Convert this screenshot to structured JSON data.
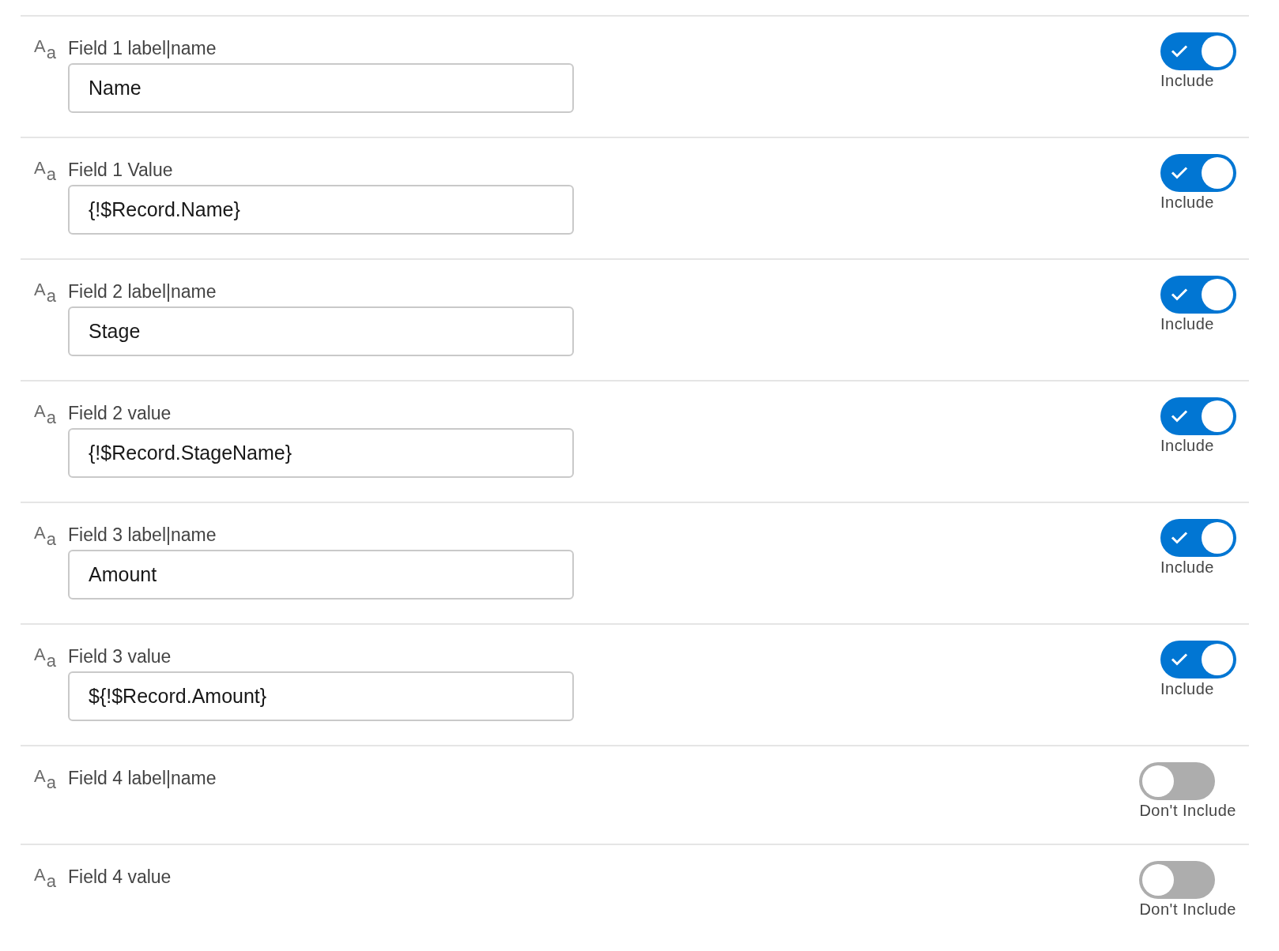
{
  "fields": [
    {
      "icon": "A$_{a}$",
      "label": "Field 1 label|name",
      "value": "Name",
      "include": {
        "checked": true,
        "label": "Include"
      }
    },
    {
      "icon": "A$_{a}$",
      "label": "Field 1 Value",
      "value": "{!$Record.Name}",
      "include": {
        "checked": true,
        "label": "Include"
      }
    },
    {
      "icon": "A$_{a}$",
      "label": "Field 2 label|name",
      "value": "Stage",
      "include": {
        "checked": true,
        "label": "Include"
      }
    },
    {
      "icon": "A$_{a}$",
      "label": "Field 2 value",
      "value": "{!$Record.StageName}",
      "include": {
        "checked": true,
        "label": "Include"
      }
    },
    {
      "icon": "A$_{a}$",
      "label": "Field 3 label|name",
      "value": "Amount",
      "include": {
        "checked": true,
        "label": "Include"
      }
    },
    {
      "icon": "A$_{a}$",
      "label": "Field 3 value",
      "value": "${!$Record.Amount}",
      "include": {
        "checked": true,
        "label": "Include"
      }
    },
    {
      "icon": "A$_{a}$",
      "label": "Field 4 label|name",
      "include": {
        "checked": false,
        "label": "Don't Include"
      }
    },
    {
      "icon": "A$_{a}$",
      "label": "Field 4 value",
      "include": {
        "checked": false,
        "label": "Don't Include"
      }
    }
  ]
}
